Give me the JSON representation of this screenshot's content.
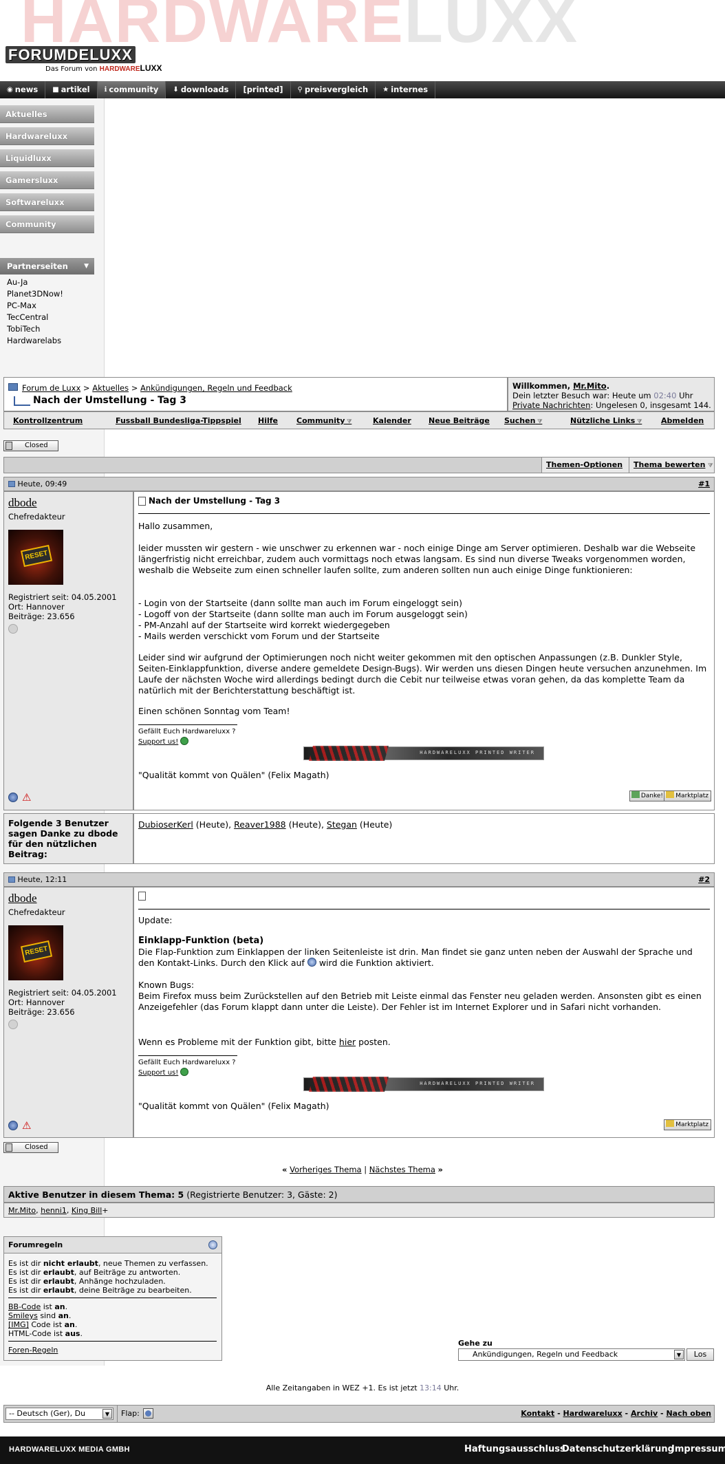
{
  "header": {
    "big_word_a": "HARDWARE",
    "big_word_b": "LUXX",
    "logo_text": "FORUMDELUXX",
    "logo_sub_prefix": "Das Forum von ",
    "logo_sub_hw": "HARDWARE",
    "logo_sub_luxx": "LUXX"
  },
  "topnav": [
    {
      "icon": "◉",
      "label": "news"
    },
    {
      "icon": "■",
      "label": "artikel"
    },
    {
      "icon": "ℹ",
      "label": "community",
      "active": true
    },
    {
      "icon": "⬇",
      "label": "downloads"
    },
    {
      "icon": "",
      "label": "[printed]"
    },
    {
      "icon": "⚲",
      "label": "preisvergleich"
    },
    {
      "icon": "★",
      "label": "internes"
    }
  ],
  "sidebar": {
    "items": [
      "Aktuelles",
      "Hardwareluxx",
      "Liquidluxx",
      "Gamersluxx",
      "Softwareluxx",
      "Community"
    ],
    "partner_title": "Partnerseiten",
    "partners": [
      "Au-Ja",
      "Planet3DNow!",
      "PC-Max",
      "TecCentral",
      "TobiTech",
      "Hardwarelabs"
    ]
  },
  "breadcrumb": {
    "forum": "Forum de Luxx",
    "sep": ">",
    "cat": "Aktuelles",
    "sub": "Ankündigungen, Regeln und Feedback",
    "thread": "Nach der Umstellung - Tag 3"
  },
  "welcome": {
    "title_prefix": "Willkommen, ",
    "user": "Mr.Mito",
    "line1_prefix": "Dein letzter Besuch war: Heute um ",
    "time": "02:40",
    "line1_suffix": " Uhr",
    "pm_link": "Private Nachrichten",
    "pm_rest": ": Ungelesen 0, insgesamt 144."
  },
  "navbar": [
    "Kontrollzentrum",
    "Fussball Bundesliga-Tippspiel",
    "Hilfe",
    "Community",
    "Kalender",
    "Neue Beiträge",
    "Suchen",
    "Nützliche Links",
    "Abmelden"
  ],
  "closed_label": "Closed",
  "thread_tools": {
    "options": "Themen-Optionen",
    "rate": "Thema bewerten"
  },
  "posts": [
    {
      "date": "Heute, 09:49",
      "num": "#1",
      "username": "dbode",
      "usertitle": "Chefredakteur",
      "avatar_text": "RESET",
      "reg": "Registriert seit: 04.05.2001",
      "loc": "Ort: Hannover",
      "count": "Beiträge: 23.656",
      "title": "Nach der Umstellung - Tag 3",
      "p1": "Hallo zusammen,",
      "p2": "leider mussten wir gestern - wie unschwer zu erkennen war - noch einige Dinge am Server optimieren. Deshalb war die Webseite längerfristig nicht erreichbar, zudem auch vormittags noch etwas langsam. Es sind nun diverse Tweaks vorgenommen worden, weshalb die Webseite zum einen schneller laufen sollte, zum anderen sollten nun auch einige Dinge funktionieren:",
      "p3": "- Login von der Startseite (dann sollte man auch im Forum eingeloggt sein)\n- Logoff von der Startseite (dann sollte man auch im Forum ausgeloggt sein)\n- PM-Anzahl auf der Startseite wird korrekt wiedergegeben\n- Mails werden verschickt vom Forum und der Startseite",
      "p4": "Leider sind wir aufgrund der Optimierungen noch nicht weiter gekommen mit den optischen Anpassungen (z.B. Dunkler Style, Seiten-Einklappfunktion, diverse andere gemeldete Design-Bugs). Wir werden uns diesen Dingen heute versuchen anzunehmen. Im Laufe der nächsten Woche wird allerdings bedingt durch die Cebit nur teilweise etwas voran gehen, da das komplette Team da natürlich mit der Berichterstattung beschäftigt ist.",
      "p5": "Einen schönen Sonntag vom Team!",
      "sig1": "Gefällt Euch Hardwareluxx ?",
      "sig2": "Support us!",
      "banner_text": "HARDWARELUXX PRINTED WRITER",
      "quote": "\"Qualität kommt von Quälen\" (Felix Magath)",
      "thanks_btn": "Danke!",
      "market_btn": "Marktplatz"
    },
    {
      "date": "Heute, 12:11",
      "num": "#2",
      "username": "dbode",
      "usertitle": "Chefredakteur",
      "avatar_text": "RESET",
      "reg": "Registriert seit: 04.05.2001",
      "loc": "Ort: Hannover",
      "count": "Beiträge: 23.656",
      "p1": "Update:",
      "p2_title": "Einklapp-Funktion (beta)",
      "p2a": "Die Flap-Funktion zum Einklappen der linken Seitenleiste ist drin. Man findet sie ganz unten neben der Auswahl der Sprache und den Kontakt-Links. Durch den Klick auf",
      "p2b": "wird die Funktion aktiviert.",
      "p3": "Known Bugs:\nBeim Firefox muss beim Zurückstellen auf den Betrieb mit Leiste einmal das Fenster neu geladen werden. Ansonsten gibt es einen Anzeigefehler (das Forum klappt dann unter die Leiste). Der Fehler ist im Internet Explorer und in Safari nicht vorhanden.",
      "p4a": "Wenn es Probleme mit der Funktion gibt, bitte ",
      "p4link": "hier",
      "p4b": " posten.",
      "sig1": "Gefällt Euch Hardwareluxx ?",
      "sig2": "Support us!",
      "banner_text": "HARDWARELUXX PRINTED WRITER",
      "quote": "\"Qualität kommt von Quälen\" (Felix Magath)",
      "market_btn": "Marktplatz"
    }
  ],
  "thanks": {
    "label": "Folgende 3 Benutzer sagen Danke zu dbode für den nützlichen Beitrag:",
    "users": [
      {
        "name": "DubioserKerl",
        "when": " (Heute), "
      },
      {
        "name": "Reaver1988",
        "when": " (Heute), "
      },
      {
        "name": "Stegan",
        "when": " (Heute)"
      }
    ]
  },
  "thread_nav": {
    "prev": "Vorheriges Thema",
    "sep": "|",
    "next": "Nächstes Thema",
    "lq": "«",
    "rq": "»"
  },
  "active_users": {
    "title": "Aktive Benutzer in diesem Thema: 5",
    "detail": " (Registrierte Benutzer: 3, Gäste: 2)",
    "u1": "Mr.Mito",
    "u2": "henni1",
    "u3": "King Bill",
    "plus": "+"
  },
  "forumrules": {
    "title": "Forumregeln",
    "r1a": "Es ist dir ",
    "r1b": "nicht erlaubt",
    "r1c": ", neue Themen zu verfassen.",
    "r2a": "Es ist dir ",
    "r2b": "erlaubt",
    "r2c": ", auf Beiträge zu antworten.",
    "r3a": "Es ist dir ",
    "r3b": "erlaubt",
    "r3c": ", Anhänge hochzuladen.",
    "r4a": "Es ist dir ",
    "r4b": "erlaubt",
    "r4c": ", deine Beiträge zu bearbeiten.",
    "bb": "BB-Code",
    "bb_rest": " ist ",
    "bb_val": "an",
    "sm": "Smileys",
    "sm_rest": " sind ",
    "sm_val": "an",
    "img": "[IMG]",
    "img_rest": " Code ist ",
    "img_val": "an",
    "html": "HTML-Code ist ",
    "html_val": "aus",
    "rules_link": "Foren-Regeln"
  },
  "goto": {
    "label": "Gehe zu",
    "selected": "Ankündigungen, Regeln und Feedback",
    "button": "Los"
  },
  "timezone": {
    "text": "Alle Zeitangaben in WEZ +1. Es ist jetzt ",
    "time": "13:14",
    "suffix": " Uhr."
  },
  "bottom": {
    "lang": "-- Deutsch (Ger), Du",
    "flap": "Flap:",
    "links": [
      "Kontakt",
      "Hardwareluxx",
      "Archiv",
      "Nach oben"
    ],
    "sep": "-"
  },
  "footer": {
    "company": "HARDWARELUXX MEDIA GMBH",
    "links": [
      "Haftungsausschluss",
      "Datenschutzerklärung",
      "Impressum"
    ]
  },
  "colors": {
    "accent_red": "#c0281d",
    "time_gray": "#7a7a9a"
  }
}
